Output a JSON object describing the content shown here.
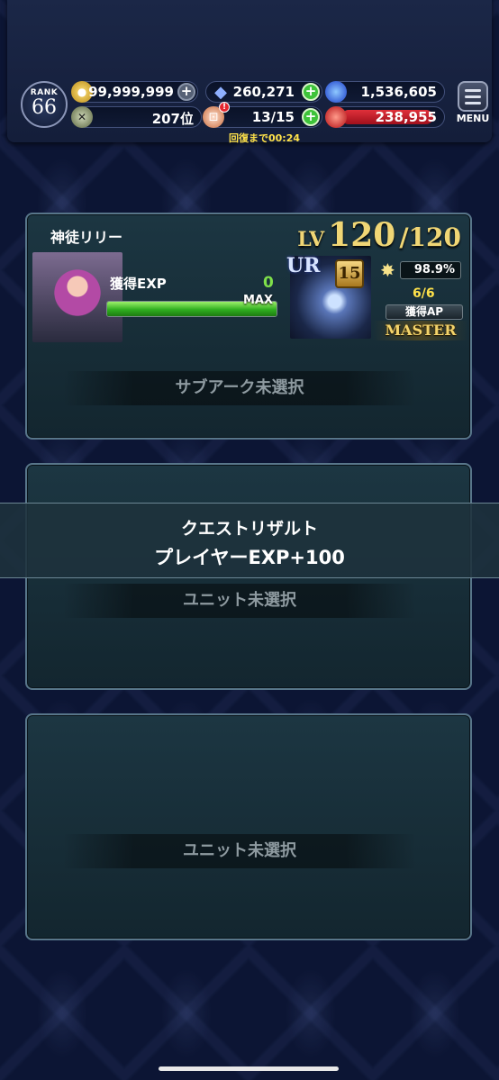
{
  "header": {
    "rank_label": "RANK",
    "rank_value": "66",
    "gold": "99,999,999",
    "crystals": "260,271",
    "blue_orbs": "1,536,605",
    "ranking": "207位",
    "stamina": "13/15",
    "red_orbs": "238,955",
    "recover_timer": "回復まで00:24",
    "menu_label": "MENU"
  },
  "unit_card": {
    "name": "神徒リリー",
    "level_prefix": "LV",
    "level": "120",
    "level_max": "/120",
    "exp_label": "獲得EXP",
    "exp_value": "0",
    "exp_fill": 1.0,
    "exp_max_label": "MAX",
    "weapon_rarity": "UR",
    "weapon_level": "15",
    "weapon_percent": "98.9%",
    "ap_fraction": "6/6",
    "ap_label": "獲得AP",
    "mastery": "MASTER",
    "sub_arc": "サブアーク未選択"
  },
  "slot_2": {
    "label": "ユニット未選択"
  },
  "slot_3": {
    "label": "ユニット未選択"
  },
  "result_banner": {
    "title": "クエストリザルト",
    "player_exp": "プレイヤーEXP+100"
  },
  "colors": {
    "exp_bar": "#2fae1f",
    "gold_text": "#f0d675",
    "accent_green": "#3ec33a",
    "stamina_red": "#e0303a"
  }
}
